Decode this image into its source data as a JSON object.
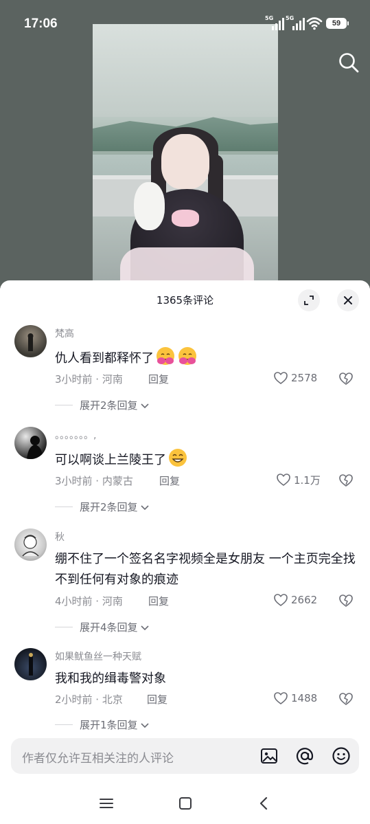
{
  "status_bar": {
    "time": "17:06",
    "signal1_label": "5G",
    "signal2_label": "5G",
    "battery": "59"
  },
  "sheet": {
    "title": "1365条评论"
  },
  "comments": [
    {
      "user": "梵高",
      "text": "仇人看到都释怀了",
      "emojis": [
        "hug-emoji",
        "hug-emoji"
      ],
      "meta": "3小时前 · 河南",
      "reply": "回复",
      "likes": "2578",
      "expand": "展开2条回复"
    },
    {
      "user": "。。。。。。。,",
      "text": "可以啊谈上兰陵王了",
      "emojis": [
        "grin-emoji"
      ],
      "meta": "3小时前 · 内蒙古",
      "reply": "回复",
      "likes": "1.1万",
      "expand": "展开2条回复"
    },
    {
      "user": "秋",
      "text": "绷不住了一个签名名字视频全是女朋友 一个主页完全找不到任何有对象的痕迹",
      "meta": "4小时前 · 河南",
      "reply": "回复",
      "likes": "2662",
      "expand": "展开4条回复"
    },
    {
      "user": "如果鱿鱼丝一种天赋",
      "text": "我和我的缉毒警对象",
      "meta": "2小时前 · 北京",
      "reply": "回复",
      "likes": "1488",
      "expand": "展开1条回复"
    }
  ],
  "input": {
    "placeholder": "作者仅允许互相关注的人评论"
  },
  "colors": {
    "primary_text": "#161823",
    "secondary_text": "#8a8b91",
    "surface": "#f1f1f2"
  }
}
